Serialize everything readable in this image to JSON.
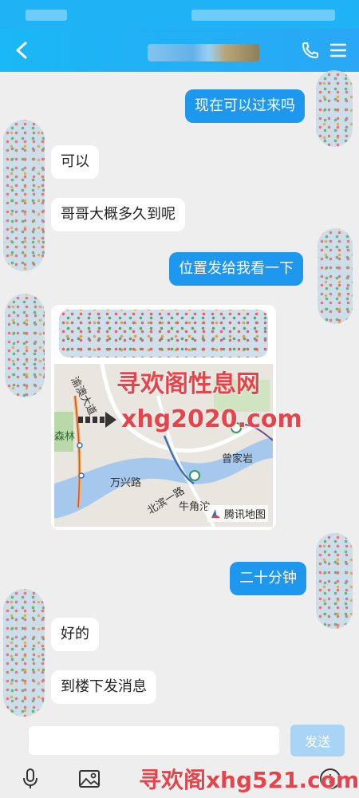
{
  "chat": {
    "messages": [
      {
        "side": "right",
        "text": "现在可以过来吗"
      },
      {
        "side": "left",
        "text": "可以"
      },
      {
        "side": "left",
        "text": "哥哥大概多久到呢"
      },
      {
        "side": "right",
        "text": "位置发给我看一下"
      },
      {
        "side": "right",
        "text": "二十分钟"
      },
      {
        "side": "left",
        "text": "好的"
      },
      {
        "side": "left",
        "text": "到楼下发消息"
      }
    ]
  },
  "map": {
    "labels": {
      "road_yuao": "渝澳大道",
      "sen": "森林",
      "wanxing": "万兴路",
      "beibin": "北滨一路",
      "zengjiayan": "曾家岩",
      "niujiaotuo": "牛角沱"
    },
    "brand": "腾讯地图"
  },
  "watermarks": {
    "map_overlay_text": "寻欢阁性息网",
    "map_overlay_url": "xhg2020.com",
    "footer_text": "寻欢阁xhg521.com"
  },
  "composer": {
    "input_value": "",
    "send_label": "发送"
  },
  "icons": {
    "back": "chevron-left-icon",
    "phone": "phone-icon",
    "menu": "menu-icon",
    "mic": "microphone-icon",
    "image": "image-icon",
    "add": "plus-circle-icon"
  },
  "colors": {
    "header": "#1ab8f4",
    "bubble_self": "#1e97ef",
    "bubble_other": "#ffffff",
    "send_disabled": "#a9d4f6",
    "watermark": "#e8434a"
  }
}
